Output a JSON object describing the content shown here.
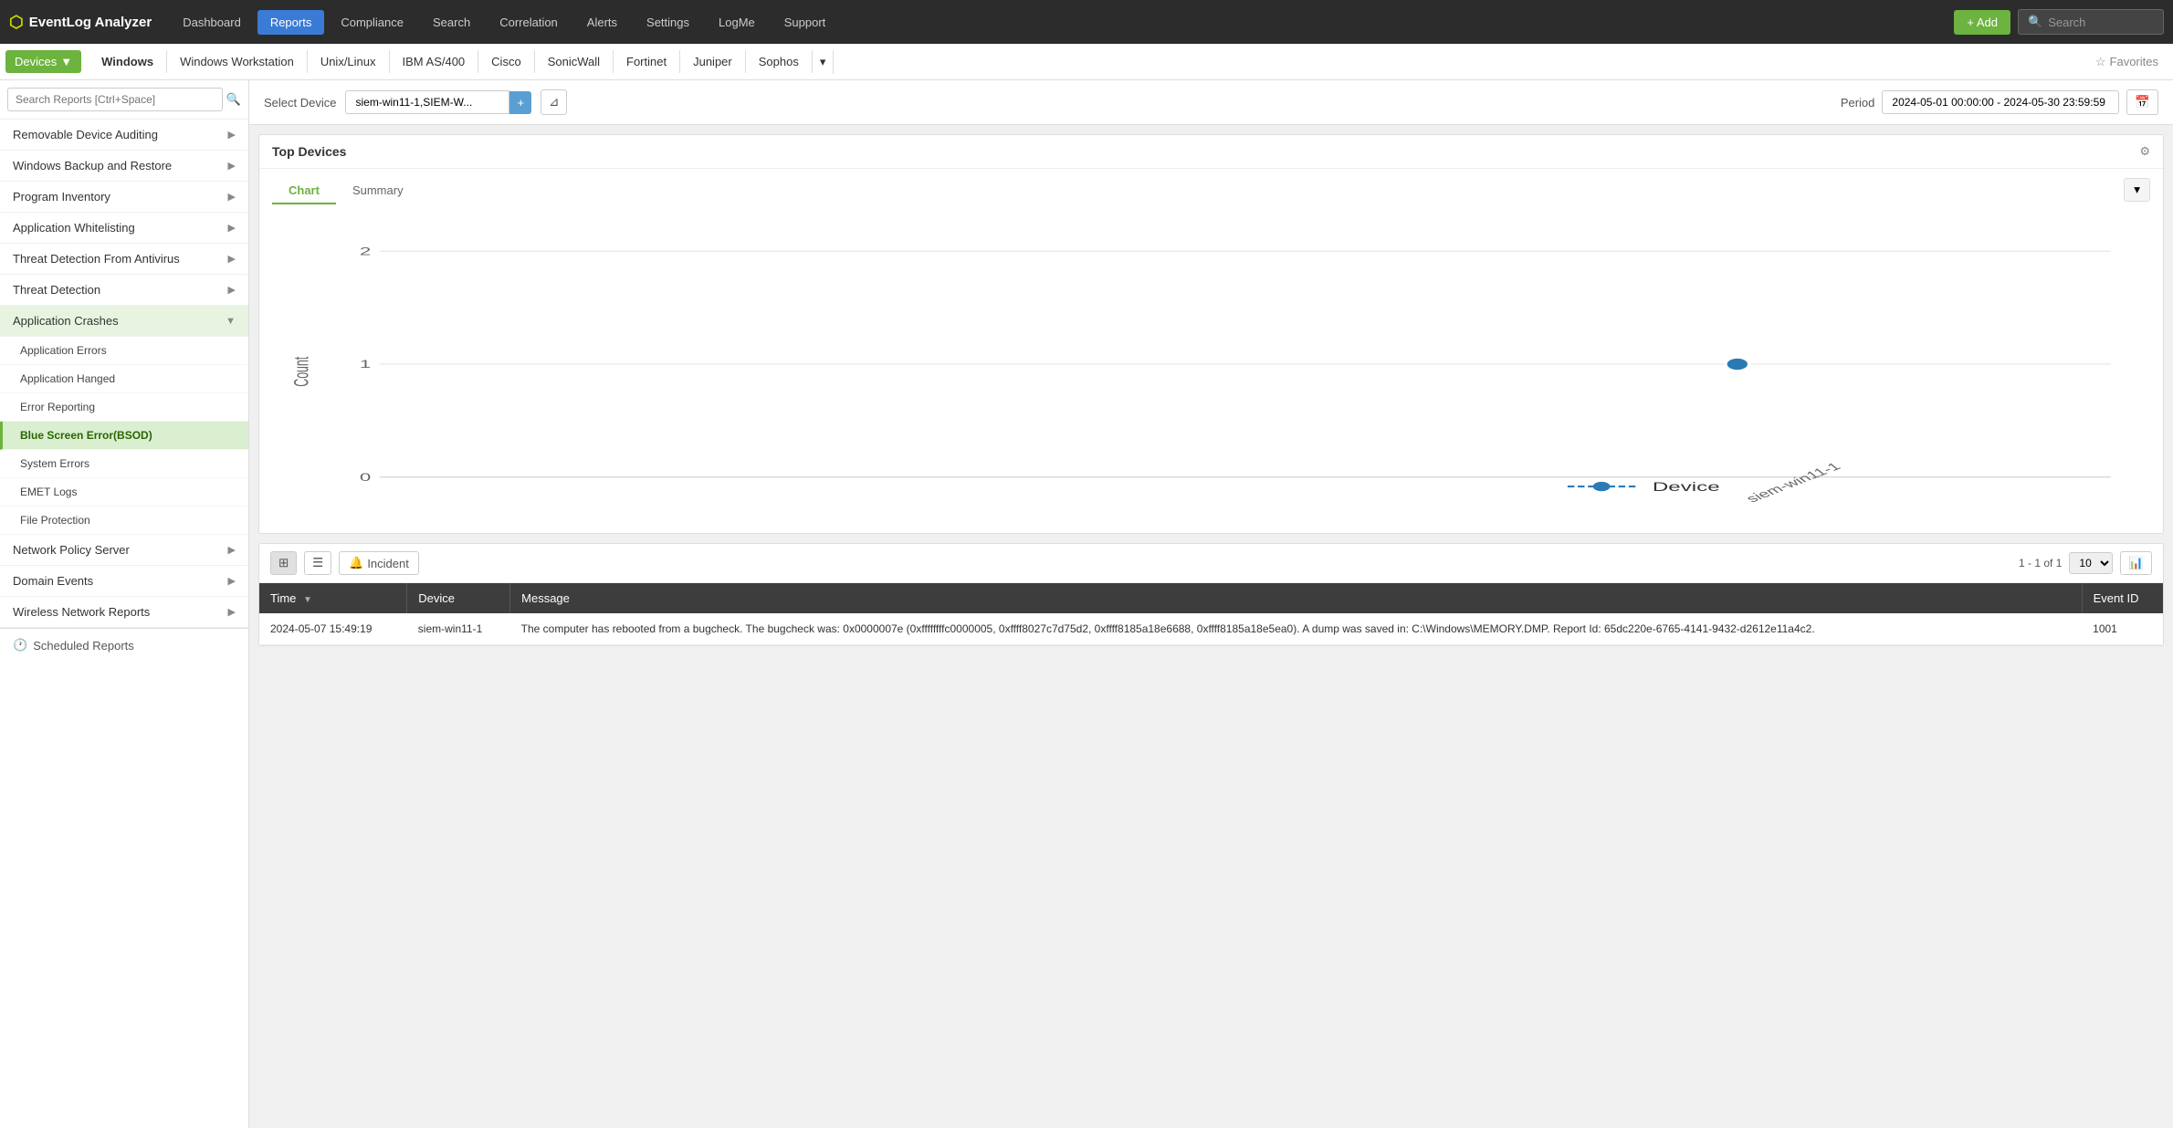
{
  "brand": {
    "logo": "⬡",
    "name": "EventLog Analyzer"
  },
  "top_nav": {
    "items": [
      {
        "label": "Dashboard",
        "active": false
      },
      {
        "label": "Reports",
        "active": true
      },
      {
        "label": "Compliance",
        "active": false
      },
      {
        "label": "Search",
        "active": false
      },
      {
        "label": "Correlation",
        "active": false
      },
      {
        "label": "Alerts",
        "active": false
      },
      {
        "label": "Settings",
        "active": false
      },
      {
        "label": "LogMe",
        "active": false
      },
      {
        "label": "Support",
        "active": false
      }
    ],
    "add_button": "+ Add",
    "search_placeholder": "Search"
  },
  "sub_nav": {
    "devices_label": "Devices",
    "items": [
      {
        "label": "Windows",
        "active": true
      },
      {
        "label": "Windows Workstation",
        "active": false
      },
      {
        "label": "Unix/Linux",
        "active": false
      },
      {
        "label": "IBM AS/400",
        "active": false
      },
      {
        "label": "Cisco",
        "active": false
      },
      {
        "label": "SonicWall",
        "active": false
      },
      {
        "label": "Fortinet",
        "active": false
      },
      {
        "label": "Juniper",
        "active": false
      },
      {
        "label": "Sophos",
        "active": false
      }
    ],
    "favorites_label": "Favorites"
  },
  "sidebar": {
    "search_placeholder": "Search Reports [Ctrl+Space]",
    "items": [
      {
        "label": "Removable Device Auditing",
        "has_arrow": true,
        "active": false
      },
      {
        "label": "Windows Backup and Restore",
        "has_arrow": true,
        "active": false
      },
      {
        "label": "Program Inventory",
        "has_arrow": true,
        "active": false
      },
      {
        "label": "Application Whitelisting",
        "has_arrow": true,
        "active": false
      },
      {
        "label": "Threat Detection From Antivirus",
        "has_arrow": true,
        "active": false
      },
      {
        "label": "Threat Detection",
        "has_arrow": true,
        "active": false
      },
      {
        "label": "Application Crashes",
        "has_arrow": true,
        "active": true,
        "expanded": true
      },
      {
        "label": "Network Policy Server",
        "has_arrow": true,
        "active": false
      },
      {
        "label": "Domain Events",
        "has_arrow": true,
        "active": false
      },
      {
        "label": "Wireless Network Reports",
        "has_arrow": true,
        "active": false
      }
    ],
    "sub_items": [
      {
        "label": "Application Errors",
        "active": false
      },
      {
        "label": "Application Hanged",
        "active": false
      },
      {
        "label": "Error Reporting",
        "active": false
      },
      {
        "label": "Blue Screen Error(BSOD)",
        "active": true
      },
      {
        "label": "System Errors",
        "active": false
      },
      {
        "label": "EMET Logs",
        "active": false
      },
      {
        "label": "File Protection",
        "active": false
      }
    ],
    "footer_label": "Scheduled Reports",
    "footer_icon": "🕐"
  },
  "content": {
    "select_device_label": "Select Device",
    "device_value": "siem-win11-1,SIEM-W...",
    "period_label": "Period",
    "period_value": "2024-05-01 00:00:00 - 2024-05-30 23:59:59"
  },
  "chart": {
    "title": "Top Devices",
    "tab_chart": "Chart",
    "tab_summary": "Summary",
    "y_label": "Count",
    "y_values": [
      "2",
      "1",
      "0"
    ],
    "x_label": "Device",
    "x_tick": "siem-win11-1",
    "data_point_x": 870,
    "data_point_y": 355,
    "legend_label": "Device"
  },
  "table": {
    "pagination_text": "1 - 1 of 1",
    "per_page": "10",
    "incident_label": "Incident",
    "columns": [
      "Time",
      "Device",
      "Message",
      "Event ID"
    ],
    "rows": [
      {
        "time": "2024-05-07 15:49:19",
        "device": "siem-win11-1",
        "message": "The computer has rebooted from a bugcheck. The bugcheck was: 0x0000007e (0xffffffffc0000005, 0xffff8027c7d75d2, 0xffff8185a18e6688, 0xffff8185a18e5ea0). A dump was saved in: C:\\Windows\\MEMORY.DMP. Report Id: 65dc220e-6765-4141-9432-d2612e11a4c2.",
        "event_id": "1001"
      }
    ]
  }
}
